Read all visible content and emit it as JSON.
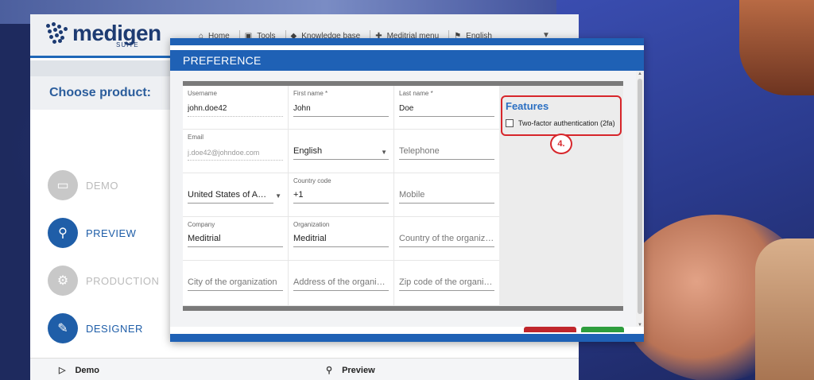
{
  "header": {
    "logo_text": "medigen",
    "logo_sub": "SUITE",
    "nav": [
      "Home",
      "Tools",
      "Knowledge base",
      "Meditrial menu",
      "English"
    ]
  },
  "sidebar": {
    "title": "Choose product:",
    "items": [
      {
        "label": "DEMO",
        "icon": "monitor-icon",
        "color": "#c8c8c8"
      },
      {
        "label": "PREVIEW",
        "icon": "search-icon",
        "color": "#1f5ea8"
      },
      {
        "label": "PRODUCTION",
        "icon": "gear-icon",
        "color": "#c8c8c8"
      },
      {
        "label": "DESIGNER",
        "icon": "edit-icon",
        "color": "#1f5ea8"
      }
    ]
  },
  "bottom_tabs": [
    "Demo",
    "Preview"
  ],
  "modal": {
    "title": "PREFERENCE",
    "fields": {
      "username": {
        "label": "Username",
        "value": "john.doe42"
      },
      "first_name": {
        "label": "First name *",
        "value": "John"
      },
      "last_name": {
        "label": "Last name *",
        "value": "Doe"
      },
      "email": {
        "label": "Email",
        "value": "j.doe42@johndoe.com"
      },
      "language": {
        "value": "English"
      },
      "telephone": {
        "placeholder": "Telephone"
      },
      "country": {
        "value": "United States of Am…"
      },
      "country_code": {
        "label": "Country code",
        "value": "+1"
      },
      "mobile": {
        "placeholder": "Mobile"
      },
      "company": {
        "label": "Company",
        "value": "Meditrial"
      },
      "organization": {
        "label": "Organization",
        "value": "Meditrial"
      },
      "org_country": {
        "placeholder": "Country of the organiz…"
      },
      "org_city": {
        "placeholder": "City of the organization"
      },
      "org_address": {
        "placeholder": "Address of the organiz…"
      },
      "org_zip": {
        "placeholder": "Zip code of the organi…"
      }
    },
    "features": {
      "title": "Features",
      "checkbox_label": "Two-factor authentication (2fa)",
      "checked": false
    },
    "step_marker": "4.",
    "colors": {
      "primary": "#1f61b5",
      "highlight": "#d7262b",
      "cancel": "#c0262c",
      "confirm": "#2d9d3d"
    }
  }
}
